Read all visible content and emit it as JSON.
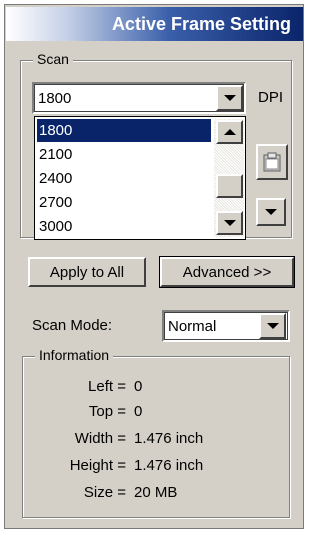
{
  "title": "Active Frame Setting",
  "scan_group": {
    "legend": "Scan",
    "dpi_value": "1800",
    "dpi_label": "DPI",
    "dpi_options": [
      "1800",
      "2100",
      "2400",
      "2700",
      "3000"
    ],
    "selected_option": "1800"
  },
  "buttons": {
    "apply_to_all": "Apply to All",
    "advanced": "Advanced >>"
  },
  "scan_mode": {
    "label": "Scan Mode:",
    "value": "Normal"
  },
  "information": {
    "legend": "Information",
    "rows": [
      {
        "key": "Left =",
        "value": "0"
      },
      {
        "key": "Top =",
        "value": "0"
      },
      {
        "key": "Width =",
        "value": "1.476 inch"
      },
      {
        "key": "Height =",
        "value": "1.476 inch"
      },
      {
        "key": "Size =",
        "value": "20 MB"
      }
    ]
  },
  "icons": [
    "chevron-down-icon",
    "chevron-up-icon",
    "clipboard-icon"
  ],
  "colors": {
    "panel": "#d4d0c8",
    "title_dark": "#0a246a",
    "selection": "#0a246a"
  }
}
